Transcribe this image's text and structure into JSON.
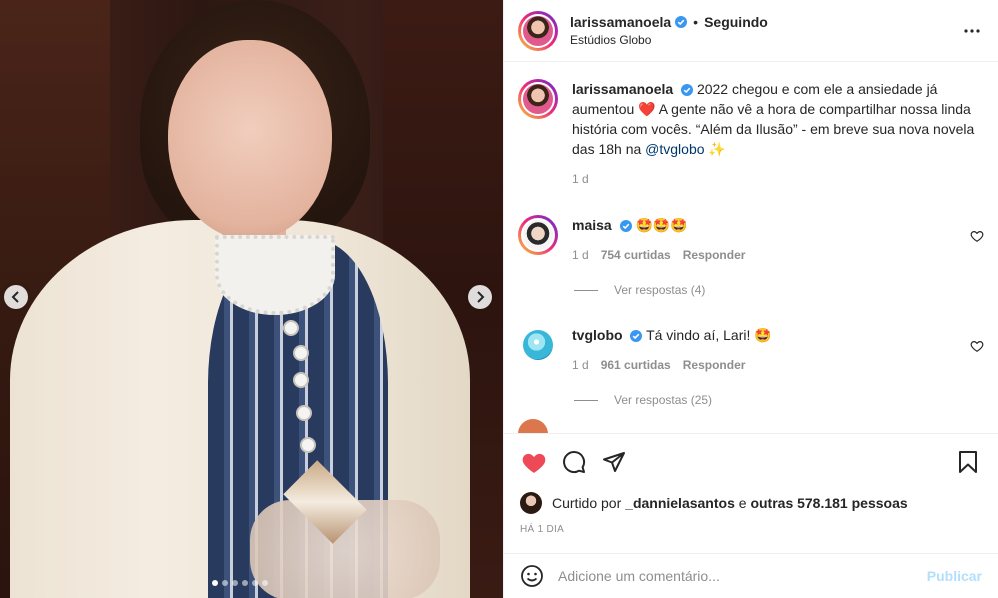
{
  "post": {
    "author": "larissamanoela",
    "follow_dot": "•",
    "follow_label": "Seguindo",
    "location": "Estúdios Globo",
    "caption_text_1": "2022 chegou e com ele a ansiedade já aumentou ",
    "caption_heart": "❤️",
    "caption_text_2": " A gente não vê a hora de compartilhar nossa linda história com vocês. “Além da Ilusão” - em breve sua nova novela das 18h na ",
    "caption_mention": "@tvglobo",
    "caption_emoji": " ✨",
    "caption_time": "1 d"
  },
  "comments": [
    {
      "user": "maisa",
      "text": "🤩🤩🤩",
      "time": "1 d",
      "likes": "754 curtidas",
      "reply": "Responder",
      "view_replies": "Ver respostas (4)"
    },
    {
      "user": "tvglobo",
      "text": "Tá vindo aí, Lari! 🤩",
      "time": "1 d",
      "likes": "961 curtidas",
      "reply": "Responder",
      "view_replies": "Ver respostas (25)"
    }
  ],
  "actions": {
    "liked_by_prefix": "Curtido por ",
    "liked_by_user": "_dannielasantos",
    "liked_by_mid": " e ",
    "liked_by_others": "outras 578.181 pessoas",
    "time_ago": "HÁ 1 DIA"
  },
  "add_comment": {
    "placeholder": "Adicione um comentário...",
    "publish_label": "Publicar"
  },
  "colors": {
    "like_red": "#ed4956",
    "verified_blue": "#3897f0",
    "publish_disabled": "#b2dffc"
  },
  "carousel": {
    "slide_count": 6,
    "active_index": 0
  }
}
